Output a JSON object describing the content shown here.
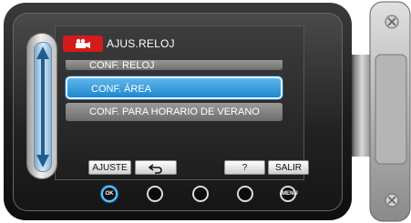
{
  "header": {
    "title": "AJUS.RELOJ",
    "badge_icon": "video-camera-icon"
  },
  "menu": {
    "items": [
      {
        "label": "CONF. RELOJ",
        "selected": false
      },
      {
        "label": "CONF. ÁREA",
        "selected": true
      },
      {
        "label": "CONF. PARA HORARIO DE VERANO",
        "selected": false
      }
    ]
  },
  "buttons": {
    "adjust": "AJUSTE",
    "back_icon": "return-arrow-icon",
    "help": "?",
    "exit": "SALIR"
  },
  "hard_buttons": {
    "ok": "OK",
    "menu": "MENU"
  },
  "colors": {
    "accent": "#1e87cc",
    "badge": "#d41a1a",
    "slider": "#8fb6d4"
  }
}
